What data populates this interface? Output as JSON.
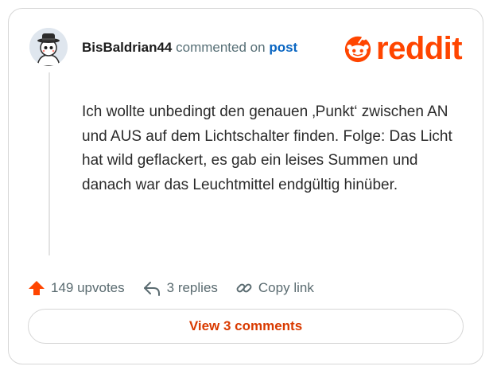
{
  "comment": {
    "username": "BisBaldrian44",
    "action_text": "commented on",
    "post_link": "post",
    "body": "Ich wollte unbedingt den genauen ‚Punkt‘ zwischen AN und AUS auf dem Lichtschalter finden. Folge: Das Licht hat wild geflackert, es gab ein leises Summen und danach war das Leuchtmittel endgültig hinüber."
  },
  "brand": {
    "name": "reddit",
    "color": "#ff4500"
  },
  "actions": {
    "upvotes": "149 upvotes",
    "replies": "3 replies",
    "copy_link": "Copy link"
  },
  "footer": {
    "view_comments": "View 3 comments"
  },
  "icons": {
    "upvote": "upvote-arrow-icon",
    "reply": "reply-arrow-icon",
    "link": "link-icon"
  },
  "colors": {
    "accent": "#ff4500",
    "link": "#0a66c2",
    "button_text": "#d93a00"
  }
}
